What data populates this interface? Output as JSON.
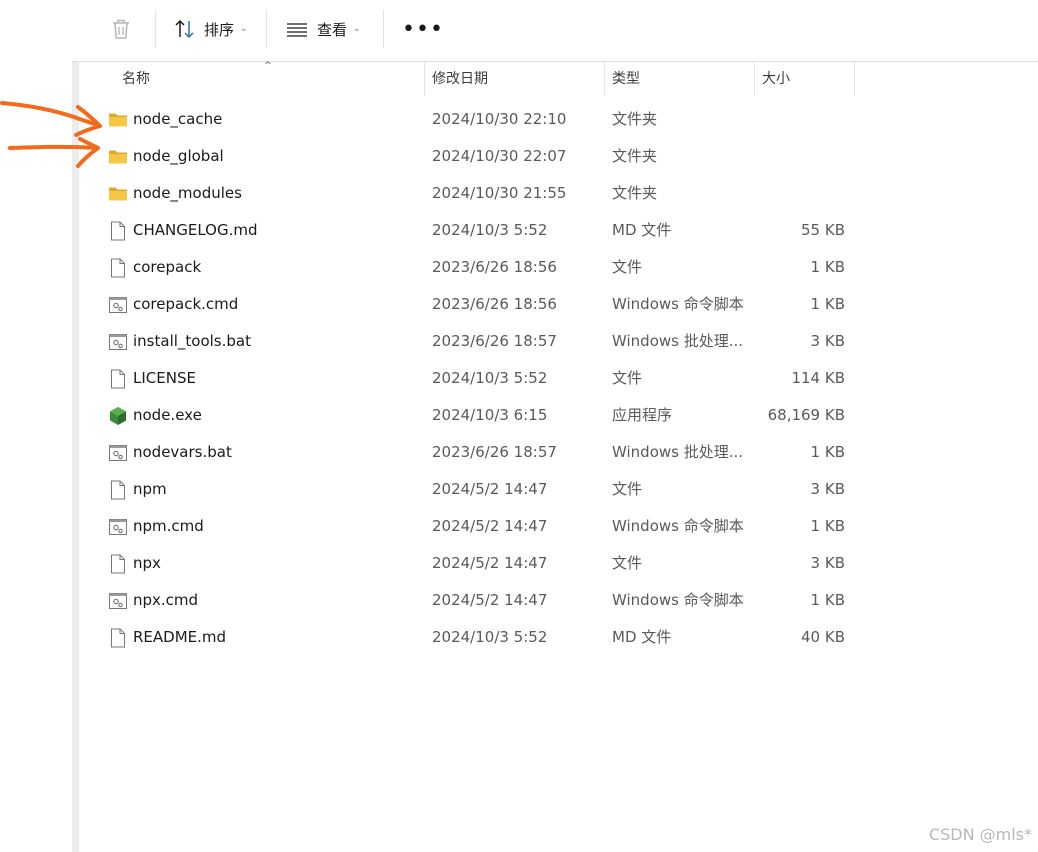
{
  "toolbar": {
    "sort_label": "排序",
    "view_label": "查看",
    "more_label": "•••"
  },
  "columns": {
    "name": "名称",
    "date": "修改日期",
    "type": "类型",
    "size": "大小"
  },
  "files": [
    {
      "name": "node_cache",
      "date": "2024/10/30 22:10",
      "type": "文件夹",
      "size": "",
      "icon": "folder-icon"
    },
    {
      "name": "node_global",
      "date": "2024/10/30 22:07",
      "type": "文件夹",
      "size": "",
      "icon": "folder-icon"
    },
    {
      "name": "node_modules",
      "date": "2024/10/30 21:55",
      "type": "文件夹",
      "size": "",
      "icon": "folder-icon"
    },
    {
      "name": "CHANGELOG.md",
      "date": "2024/10/3 5:52",
      "type": "MD 文件",
      "size": "55 KB",
      "icon": "document-icon"
    },
    {
      "name": "corepack",
      "date": "2023/6/26 18:56",
      "type": "文件",
      "size": "1 KB",
      "icon": "document-icon"
    },
    {
      "name": "corepack.cmd",
      "date": "2023/6/26 18:56",
      "type": "Windows 命令脚本",
      "size": "1 KB",
      "icon": "script-icon"
    },
    {
      "name": "install_tools.bat",
      "date": "2023/6/26 18:57",
      "type": "Windows 批处理...",
      "size": "3 KB",
      "icon": "script-icon"
    },
    {
      "name": "LICENSE",
      "date": "2024/10/3 5:52",
      "type": "文件",
      "size": "114 KB",
      "icon": "document-icon"
    },
    {
      "name": "node.exe",
      "date": "2024/10/3 6:15",
      "type": "应用程序",
      "size": "68,169 KB",
      "icon": "node-app-icon"
    },
    {
      "name": "nodevars.bat",
      "date": "2023/6/26 18:57",
      "type": "Windows 批处理...",
      "size": "1 KB",
      "icon": "script-icon"
    },
    {
      "name": "npm",
      "date": "2024/5/2 14:47",
      "type": "文件",
      "size": "3 KB",
      "icon": "document-icon"
    },
    {
      "name": "npm.cmd",
      "date": "2024/5/2 14:47",
      "type": "Windows 命令脚本",
      "size": "1 KB",
      "icon": "script-icon"
    },
    {
      "name": "npx",
      "date": "2024/5/2 14:47",
      "type": "文件",
      "size": "3 KB",
      "icon": "document-icon"
    },
    {
      "name": "npx.cmd",
      "date": "2024/5/2 14:47",
      "type": "Windows 命令脚本",
      "size": "1 KB",
      "icon": "script-icon"
    },
    {
      "name": "README.md",
      "date": "2024/10/3 5:52",
      "type": "MD 文件",
      "size": "40 KB",
      "icon": "document-icon"
    }
  ],
  "watermark": "CSDN @mls*",
  "colors": {
    "annotation_arrow": "#f26a1b",
    "folder": "#f6c645",
    "node_green": "#3c8a3c"
  }
}
